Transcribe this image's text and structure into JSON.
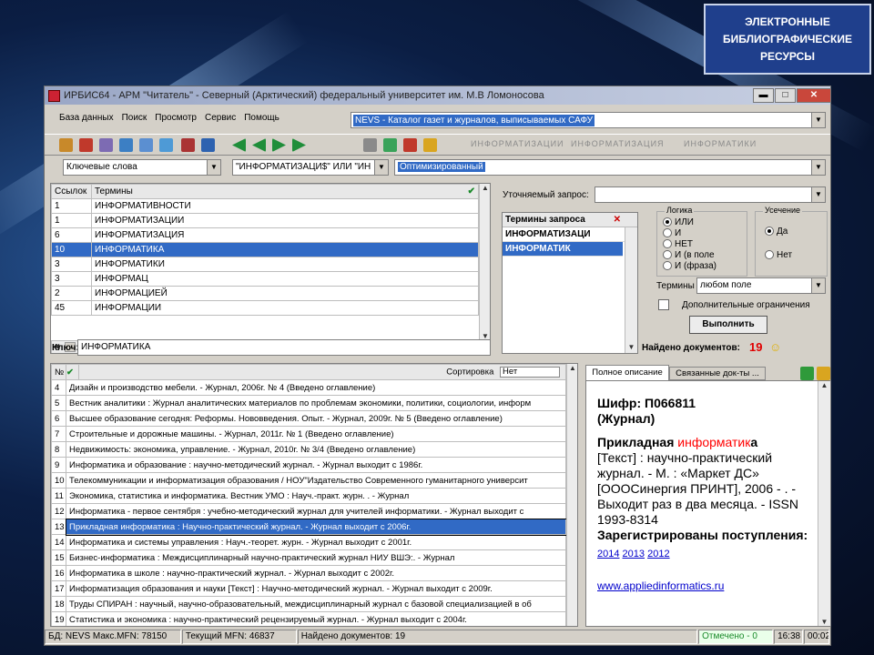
{
  "slide_badge": "ЭЛЕКТРОННЫЕ БИБЛИОГРАФИЧЕСКИЕ РЕСУРСЫ",
  "window": {
    "title": "ИРБИС64 - АРМ \"Читатель\" - Северный (Арктический) федеральный университет им. М.В Ломоносова",
    "min_label": "▬",
    "max_label": "□",
    "close_label": "✕"
  },
  "menu": {
    "items": [
      "База данных",
      "Поиск",
      "Просмотр",
      "Сервис",
      "Помощь"
    ],
    "database": "NEVS - Каталог газет и журналов, выписываемых САФУ"
  },
  "toolbar": {
    "ghost_text": [
      "ИНФОРМАТИЗАЦИИ",
      "ИНФОРМАТИЗАЦИЯ",
      "ИНФОРМАТИКИ"
    ]
  },
  "search": {
    "field_type": "Ключевые слова",
    "query": "\"ИНФОРМАТИЗАЦИ$\" ИЛИ \"ИН",
    "mode": "Оптимизированный"
  },
  "terms_panel": {
    "col_links": "Ссылок",
    "col_terms": "Термины",
    "rows": [
      {
        "count": "1",
        "term": "ИНФОРМАТИВНОСТИ"
      },
      {
        "count": "1",
        "term": "ИНФОРМАТИЗАЦИИ"
      },
      {
        "count": "6",
        "term": "ИНФОРМАТИЗАЦИЯ"
      },
      {
        "count": "10",
        "term": "ИНФОРМАТИКА"
      },
      {
        "count": "3",
        "term": "ИНФОРМАТИКИ"
      },
      {
        "count": "3",
        "term": "ИНФОРМАЦ"
      },
      {
        "count": "2",
        "term": "ИНФОРМАЦИЕЙ"
      },
      {
        "count": "45",
        "term": "ИНФОРМАЦИИ"
      }
    ],
    "selected_index": 3,
    "key_label": "Ключ:",
    "key_value": "ИНФОРМАТИКА"
  },
  "query_panel": {
    "refined_label": "Уточняемый запрос:",
    "terms_header": "Термины запроса",
    "terms": [
      "ИНФОРМАТИЗАЦИ",
      "ИНФОРМАТИК"
    ],
    "logic_label": "Логика",
    "logic_options": [
      "ИЛИ",
      "И",
      "НЕТ",
      "И (в поле",
      "И (фраза)"
    ],
    "truncation_label": "Усечение",
    "truncation_yes": "Да",
    "truncation_no": "Нет",
    "terms_in_label": "Термины в",
    "terms_in_value": "любом поле",
    "extra_label": "Дополнительные ограничения",
    "execute_label": "Выполнить",
    "found_label": "Найдено документов:",
    "found_count": "19"
  },
  "results": {
    "col_num": "№",
    "sort_label": "Сортировка",
    "sort_value": "Нет",
    "selected_index": 9,
    "rows": [
      {
        "n": "4",
        "title": "Дизайн и производство мебели. - Журнал, 2006г. № 4  (Введено оглавление)"
      },
      {
        "n": "5",
        "title": "Вестник аналитики : Журнал аналитических материалов по проблемам экономики, политики, социологии, информ"
      },
      {
        "n": "6",
        "title": "Высшее образование сегодня: Реформы. Нововведения. Опыт. - Журнал, 2009г. № 5  (Введено оглавление)"
      },
      {
        "n": "7",
        "title": "Строительные и дорожные машины. - Журнал, 2011г. № 1  (Введено оглавление)"
      },
      {
        "n": "8",
        "title": "Недвижимость: экономика, управление. - Журнал, 2010г. № 3/4  (Введено оглавление)"
      },
      {
        "n": "9",
        "title": "Информатика и образование : научно-методический журнал. - Журнал выходит с 1986г."
      },
      {
        "n": "10",
        "title": "Телекоммуникации и информатизация образования / НОУ\"Издательство Современного гуманитарного университ"
      },
      {
        "n": "11",
        "title": "Экономика, статистика и информатика. Вестник УМО : Науч.-практ. журн. . - Журнал"
      },
      {
        "n": "12",
        "title": "Информатика - первое сентября : учебно-методический журнал для учителей информатики. - Журнал выходит с"
      },
      {
        "n": "13",
        "title": "Прикладная информатика  : Научно-практический журнал. - Журнал выходит с 2006г."
      },
      {
        "n": "14",
        "title": "Информатика и системы управления : Науч.-теорет. журн. - Журнал выходит с 2001г."
      },
      {
        "n": "15",
        "title": "Бизнес-информатика : Междисциплинарный научно-практический журнал НИУ ВШЭ:. - Журнал"
      },
      {
        "n": "16",
        "title": "Информатика в школе : научно-практический журнал. - Журнал выходит с 2002г."
      },
      {
        "n": "17",
        "title": "Информатизация образования и науки [Текст] : Научно-методический журнал. - Журнал выходит с 2009г."
      },
      {
        "n": "18",
        "title": "Труды СПИРАН : научный, научно-образовательный, междисциплинарный журнал с базовой специализацией в об"
      },
      {
        "n": "19",
        "title": "Статистика и экономика : научно-практический рецензируемый журнал. - Журнал выходит с 2004г."
      }
    ]
  },
  "description": {
    "tab_full": "Полное описание",
    "tab_related": "Связанные док-ты ...",
    "cipher": "Шифр: П066811",
    "type": "(Журнал)",
    "title_prefix": "Прикладная ",
    "title_hl": "информатик",
    "title_suffix": "а",
    "body": "[Текст] : научно-практический журнал. - М. : «Маркет ДС» [ОООСинергия ПРИНТ], 2006 - . - Выходит раз в два месяца. - ISSN 1993-8314",
    "registered": "Зарегистрированы поступления:",
    "years": [
      "2014",
      "2013",
      "2012"
    ],
    "url": "www.appliedinformatics.ru"
  },
  "status": {
    "db": "БД: NEVS Макс.MFN: 78150",
    "current": "Текущий MFN: 46837",
    "found": "Найдено документов: 19",
    "marked": "Отмечено - 0",
    "time": "16:38",
    "counter": "00:02"
  },
  "colors": {
    "selection": "#316ac5",
    "highlight": "#ff0000",
    "window_bg": "#d4d0c8",
    "link": "#0000cc"
  }
}
